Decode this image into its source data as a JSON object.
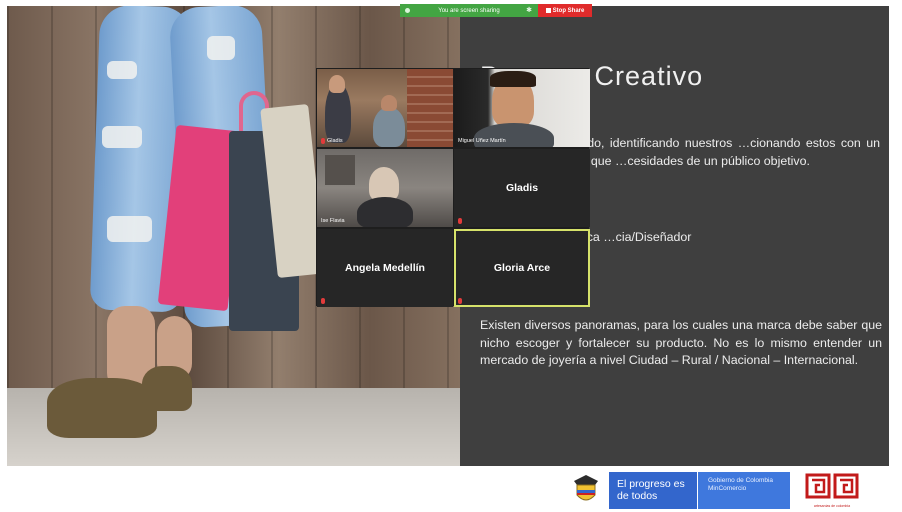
{
  "share_bar": {
    "status_text": "You are screen sharing",
    "stop_label": "Stop Share"
  },
  "slide": {
    "title": "Proceso Creativo",
    "paragraph_1": "…nichos de mercado, identificando nuestros …cionando estos con un mercado específico que …cesidades de un público objetivo.",
    "paragraph_2": "…mporánea /Artística …cia/Diseñador",
    "paragraph_3": "Existen diversos panoramas, para los cuales una marca debe saber que nicho escoger y fortalecer su producto. No es lo mismo entender un mercado de joyería a nivel Ciudad – Rural / Nacional – Internacional."
  },
  "gallery": {
    "tiles": [
      {
        "name": "Gladis",
        "type": "video"
      },
      {
        "name": "Miguel Uñez Martín",
        "type": "video"
      },
      {
        "name": "Ise Flavia",
        "type": "video"
      },
      {
        "name": "Gladis",
        "type": "name"
      },
      {
        "name": "Angela Medellín",
        "type": "name"
      },
      {
        "name": "Gloria Arce",
        "type": "name",
        "active": true
      }
    ]
  },
  "footer": {
    "progreso": "El progreso es de todos",
    "gobierno": "Gobierno de Colombia MinComercio",
    "artesanias_caption": "artesanías de colombia"
  },
  "colors": {
    "share_green": "#43a543",
    "stop_red": "#e02b2b",
    "slide_panel": "#3f3f3f",
    "active_speaker": "#d6e26a",
    "gov_blue": "#3366cc"
  }
}
